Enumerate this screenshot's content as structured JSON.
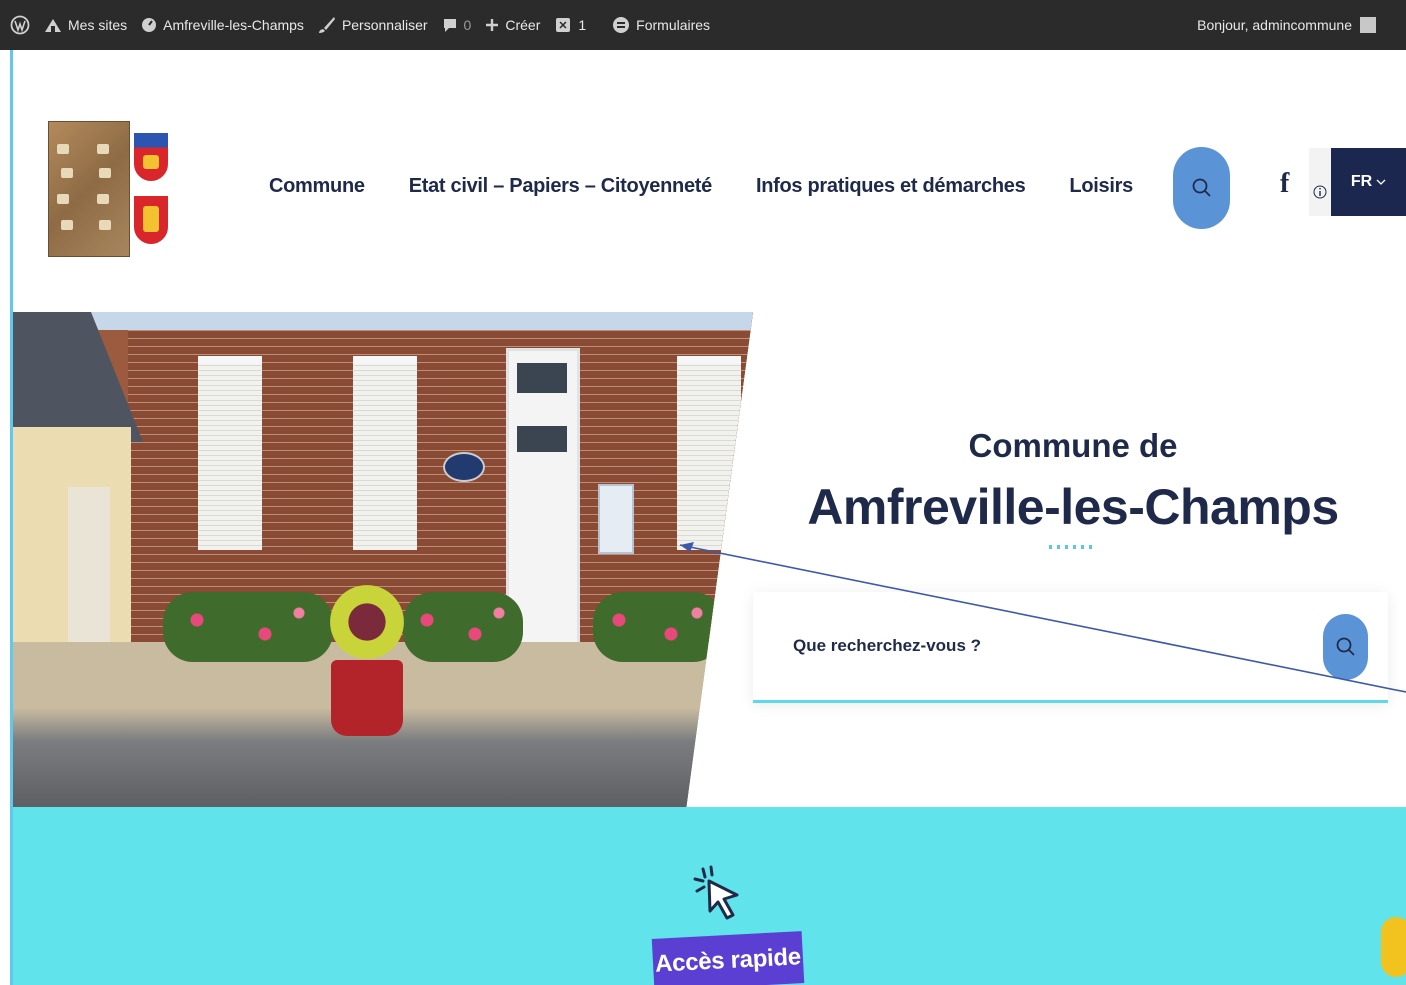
{
  "admin_bar": {
    "my_sites": "Mes sites",
    "site_name": "Amfreville-les-Champs",
    "customize": "Personnaliser",
    "comments_count": "0",
    "create": "Créer",
    "updates_count": "1",
    "forms": "Formulaires",
    "greeting": "Bonjour, admincommune"
  },
  "nav": {
    "items": [
      {
        "label": "Commune"
      },
      {
        "label": "Etat civil – Papiers – Citoyenneté"
      },
      {
        "label": "Infos pratiques et démarches"
      },
      {
        "label": "Loisirs"
      }
    ],
    "facebook": "f",
    "language": "FR"
  },
  "hero": {
    "subtitle": "Commune de",
    "title": "Amfreville-les-Champs",
    "search_placeholder": "Que recherchez-vous ?"
  },
  "quick_access": {
    "label": "Accès rapide"
  },
  "colors": {
    "admin_bar": "#2b2b2b",
    "navy": "#1f2a4a",
    "accent_blue": "#5b94d6",
    "turquoise": "#60e3ea",
    "purple": "#5b3fd3",
    "lang_bg": "#1c2750"
  },
  "icons": {
    "wordpress": "wordpress-icon",
    "sites": "my-sites-icon",
    "dashboard": "dashboard-icon",
    "brush": "customize-brush-icon",
    "comment": "comment-icon",
    "plus": "plus-icon",
    "updates": "updates-icon",
    "forms": "forms-icon",
    "search": "search-icon",
    "info": "info-icon",
    "cursor": "cursor-click-icon"
  }
}
